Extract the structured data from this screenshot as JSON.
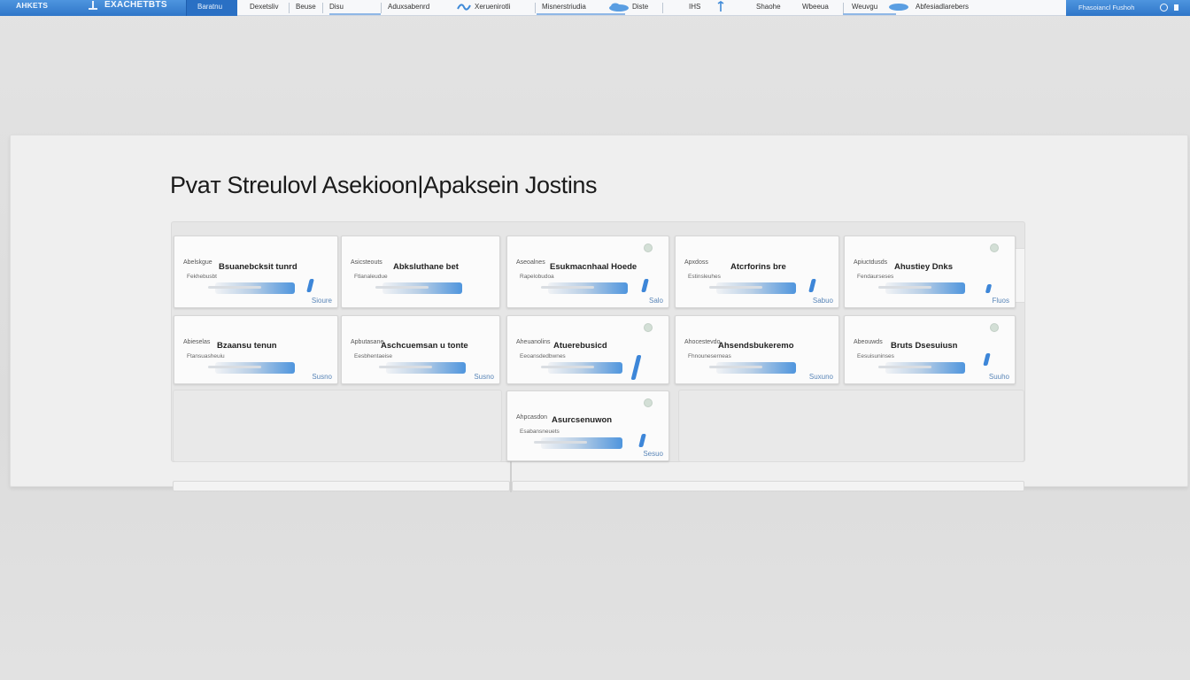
{
  "topbar": {
    "brand_code": "AHKETS",
    "brand_name": "EXACHETBTS",
    "brand_tab": "Baratnu",
    "nav": [
      {
        "label": "Dexetsliv"
      },
      {
        "label": "Beuse"
      },
      {
        "label": "Disu"
      },
      {
        "label": "Aduxsabenrd"
      },
      {
        "label": "Xeruenirotli"
      },
      {
        "label": "Misnerstriudia"
      },
      {
        "label": "Diste"
      },
      {
        "label": "IHS"
      },
      {
        "label": "Shaohe"
      },
      {
        "label": "Wbeeua"
      },
      {
        "label": "Weuvgu"
      },
      {
        "label": "Abfesiadlarebers"
      }
    ],
    "right_label": "Fhasoiancl Fushoh"
  },
  "page_title": "Pvaт Streulovl Asekioon|Apaksein Jostins",
  "cards": [
    {
      "small": "Abelskgue",
      "title": "Bsuanebcksit tunrd",
      "sub": "Fekhebusbt",
      "code": "Sioure"
    },
    {
      "small": "Asicsteouts",
      "title": "Abksluthane bet",
      "sub": "Ftlanaleudue",
      "code": ""
    },
    {
      "small": "Aseoalnes",
      "title": "Esukmacnhaal Hoede",
      "sub": "Rapelobudoa",
      "code": "Salo"
    },
    {
      "small": "Apxdoss",
      "title": "Atcrforins bre",
      "sub": "Estinsleuhes",
      "code": "Sabuo"
    },
    {
      "small": "Apiuctdusds",
      "title": "Ahustiey Dnks",
      "sub": "Fendaurseses",
      "code": "Fluos"
    },
    {
      "small": "Abieselas",
      "title": "Bzaansu tenun",
      "sub": "Ftansuasheuiu",
      "code": "Susno"
    },
    {
      "small": "Apbutasane",
      "title": "Aschcuemsan u tonte",
      "sub": "Eesbhentaeise",
      "code": "Susno"
    },
    {
      "small": "Aheuanolins",
      "title": "Atuerebusicd",
      "sub": "Eeoansdedbwnes",
      "code": ""
    },
    {
      "small": "Ahocestevdo",
      "title": "Ahsendsbukeremo",
      "sub": "Fhnouneserneas",
      "code": "Suxuno"
    },
    {
      "small": "Abeouwds",
      "title": "Bruts Dsesuiusn",
      "sub": "Eesuisuninses",
      "code": "Suuho"
    },
    {
      "small": "Ahpcasdon",
      "title": "Asurcsenuwon",
      "sub": "Esabansneuets",
      "code": "Sesuo"
    }
  ],
  "colors": {
    "accent": "#3479cc",
    "progress": "#4f95dd"
  }
}
